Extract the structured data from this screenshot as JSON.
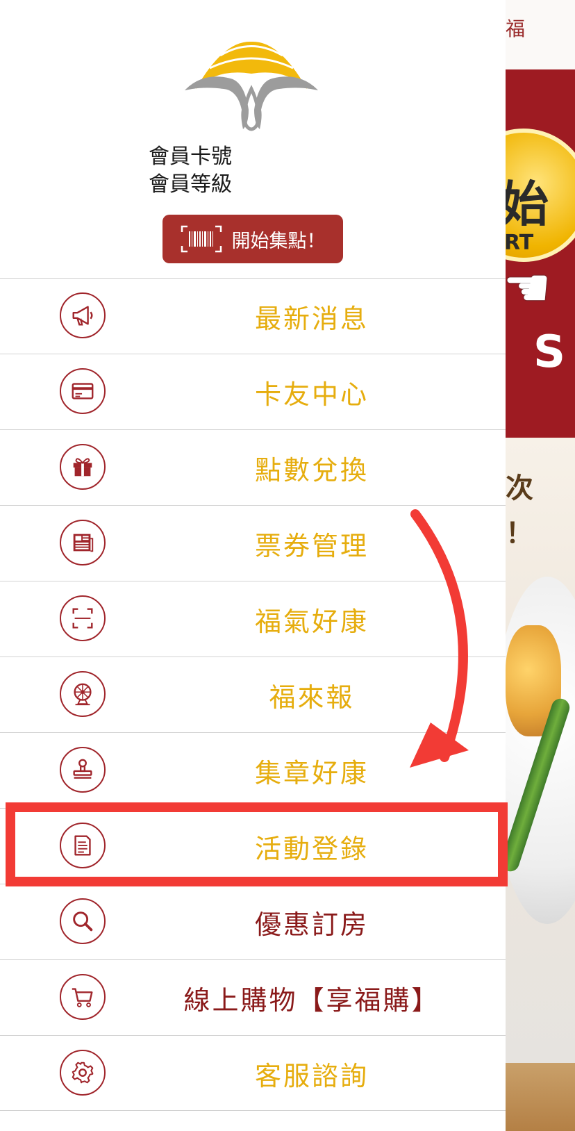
{
  "header": {
    "member_card_label": "會員卡號",
    "member_level_label": "會員等級",
    "start_button_label": "開始集點！"
  },
  "menu": {
    "items": [
      {
        "label": "最新消息",
        "icon": "megaphone-icon"
      },
      {
        "label": "卡友中心",
        "icon": "card-icon"
      },
      {
        "label": "點數兌換",
        "icon": "gift-icon"
      },
      {
        "label": "票券管理",
        "icon": "newspaper-icon"
      },
      {
        "label": "福氣好康",
        "icon": "scan-icon"
      },
      {
        "label": "福來報",
        "icon": "wheel-icon"
      },
      {
        "label": "集章好康",
        "icon": "stamp-icon"
      },
      {
        "label": "活動登錄",
        "icon": "receipt-icon"
      },
      {
        "label": "優惠訂房",
        "icon": "search-icon"
      },
      {
        "label": "線上購物【享福購】",
        "icon": "cart-icon"
      },
      {
        "label": "客服諮詢",
        "icon": "gear-icon"
      }
    ]
  },
  "background": {
    "top_char": "福",
    "big_char": "始",
    "small_text": "RT",
    "cream_char1": "次",
    "cream_char2": "！"
  },
  "colors": {
    "accent_red": "#a8302c",
    "menu_gold": "#e6ad0e",
    "menu_dark_red": "#8a1a1a",
    "highlight": "#f23b35"
  }
}
